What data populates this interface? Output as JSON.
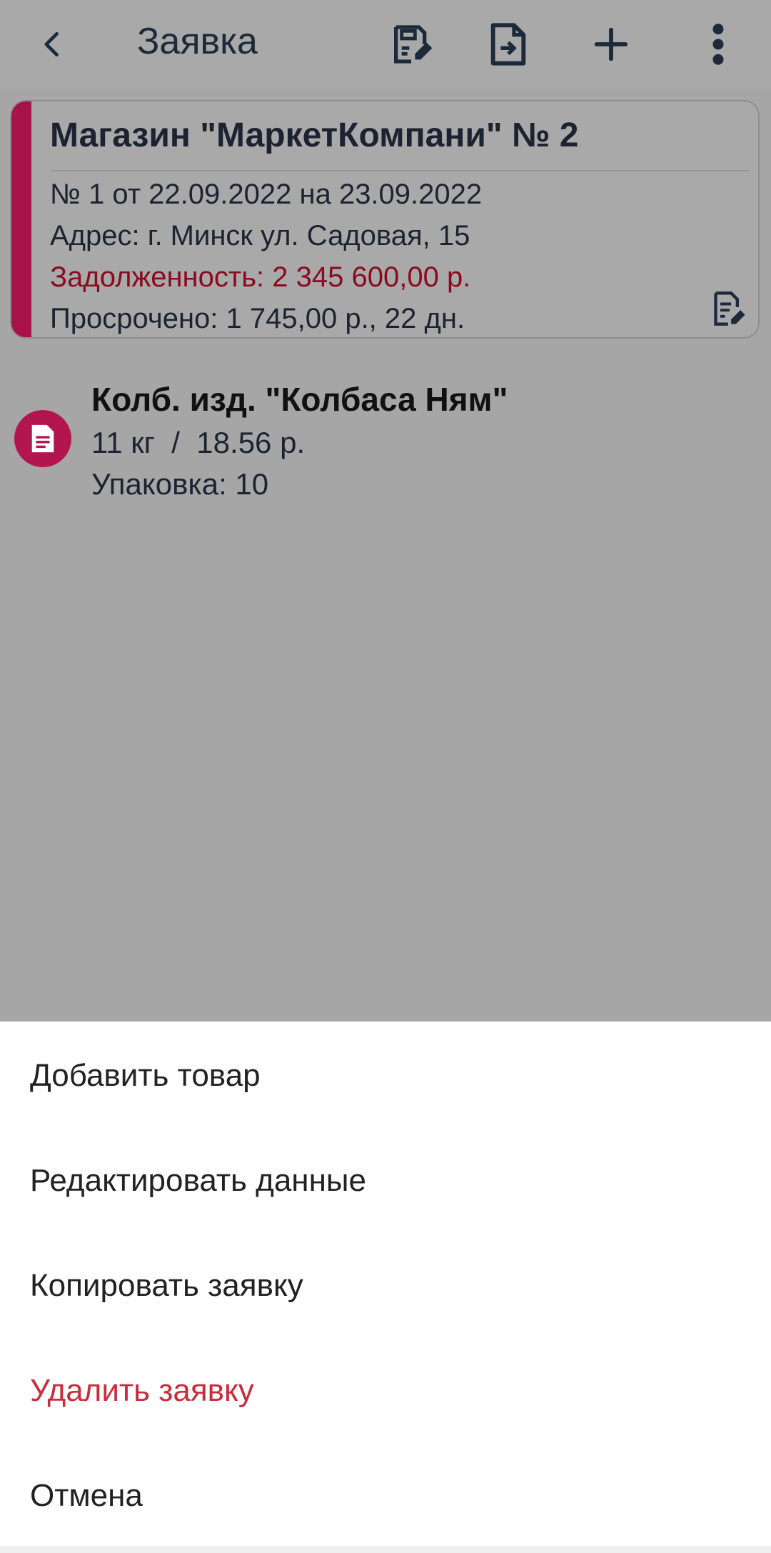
{
  "appbar": {
    "title": "Заявка",
    "icons": [
      "back-icon",
      "edit-document-icon",
      "export-document-icon",
      "plus-icon",
      "more-vert-icon"
    ]
  },
  "card": {
    "store": "Магазин \"МаркетКомпани\" № 2",
    "order": "№ 1 от 22.09.2022 на 23.09.2022",
    "address": "Адрес: г. Минск ул. Садовая, 15",
    "debt": "Задолженность: 2 345 600,00 р.",
    "overdue": "Просрочено: 1 745,00 р., 22 дн.",
    "accent_color": "#a81248",
    "debt_color": "#8b0a1e"
  },
  "item": {
    "name": "Колб. изд. \"Колбаса Ням\"",
    "qty_price": "11 кг  /  18.56 р.",
    "pack": "Упаковка: 10"
  },
  "sheet": {
    "options": [
      {
        "label": "Добавить товар"
      },
      {
        "label": "Редактировать данные"
      },
      {
        "label": "Копировать заявку"
      },
      {
        "label": "Удалить заявку",
        "color": "#c72d3a"
      },
      {
        "label": "Отмена"
      }
    ]
  }
}
